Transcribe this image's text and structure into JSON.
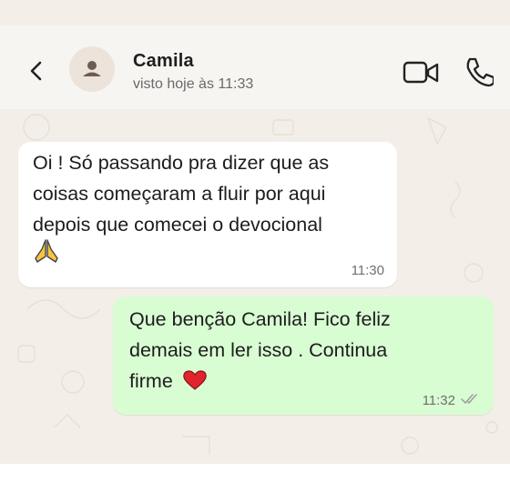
{
  "header": {
    "contact_name": "Camila",
    "status": "visto hoje às 11:33",
    "icons": {
      "back": "chevron-left-icon",
      "avatar": "person-placeholder-icon",
      "video_call": "video-camera-icon",
      "voice_call": "phone-icon"
    }
  },
  "messages": [
    {
      "direction": "incoming",
      "lines": [
        "Oi ! Só passando pra dizer que as",
        "coisas começaram a fluir por aqui",
        "depois que comecei o devocional"
      ],
      "emoji": "praying-hands-emoji",
      "time": "11:30"
    },
    {
      "direction": "outgoing",
      "lines": [
        "Que benção Camila! Fico feliz",
        "demais em ler isso . Continua",
        "firme"
      ],
      "emoji": "red-heart-emoji",
      "time": "11:32",
      "status_icon": "double-check-icon"
    }
  ],
  "colors": {
    "chat_background": "#f3efe8",
    "incoming_bubble": "#ffffff",
    "outgoing_bubble": "#d9fdd3",
    "heart": "#e0242d"
  }
}
